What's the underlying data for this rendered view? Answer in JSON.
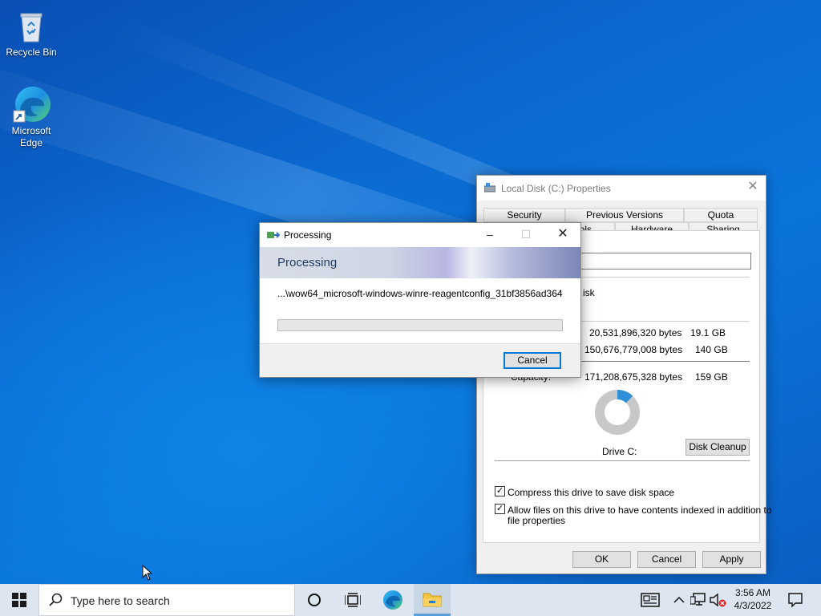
{
  "desktop": {
    "icons": [
      {
        "label": "Recycle Bin",
        "icon": "recycle-bin-icon"
      },
      {
        "label": "Microsoft Edge",
        "icon": "edge-icon"
      }
    ]
  },
  "properties": {
    "title": "Local Disk (C:) Properties",
    "tabs_row1": [
      "Security",
      "Previous Versions",
      "Quota"
    ],
    "tabs_row2": [
      "ols",
      "Hardware",
      "Sharing"
    ],
    "type_partial": "isk",
    "used_bytes": "20,531,896,320 bytes",
    "used_size": "19.1 GB",
    "free_bytes": "150,676,779,008 bytes",
    "free_size": "140 GB",
    "capacity_label": "Capacity:",
    "capacity_bytes": "171,208,675,328 bytes",
    "capacity_size": "159 GB",
    "drive_label": "Drive C:",
    "disk_cleanup": "Disk Cleanup",
    "compress_label": "Compress this drive to save disk space",
    "index_label_1": "Allow files on this drive to have contents indexed in addition to",
    "index_label_2": "file properties",
    "compress_checked": true,
    "index_checked": true,
    "used_fraction": 0.12,
    "ok": "OK",
    "cancel": "Cancel",
    "apply": "Apply",
    "colors": {
      "used": "#2f90d8",
      "free": "#c8c8c8"
    }
  },
  "processing": {
    "title": "Processing",
    "heading": "Processing",
    "path": "...\\wow64_microsoft-windows-winre-reagentconfig_31bf3856ad364",
    "progress": 0,
    "cancel": "Cancel"
  },
  "taskbar": {
    "search_placeholder": "Type here to search",
    "time": "3:56 AM",
    "date": "4/3/2022"
  }
}
